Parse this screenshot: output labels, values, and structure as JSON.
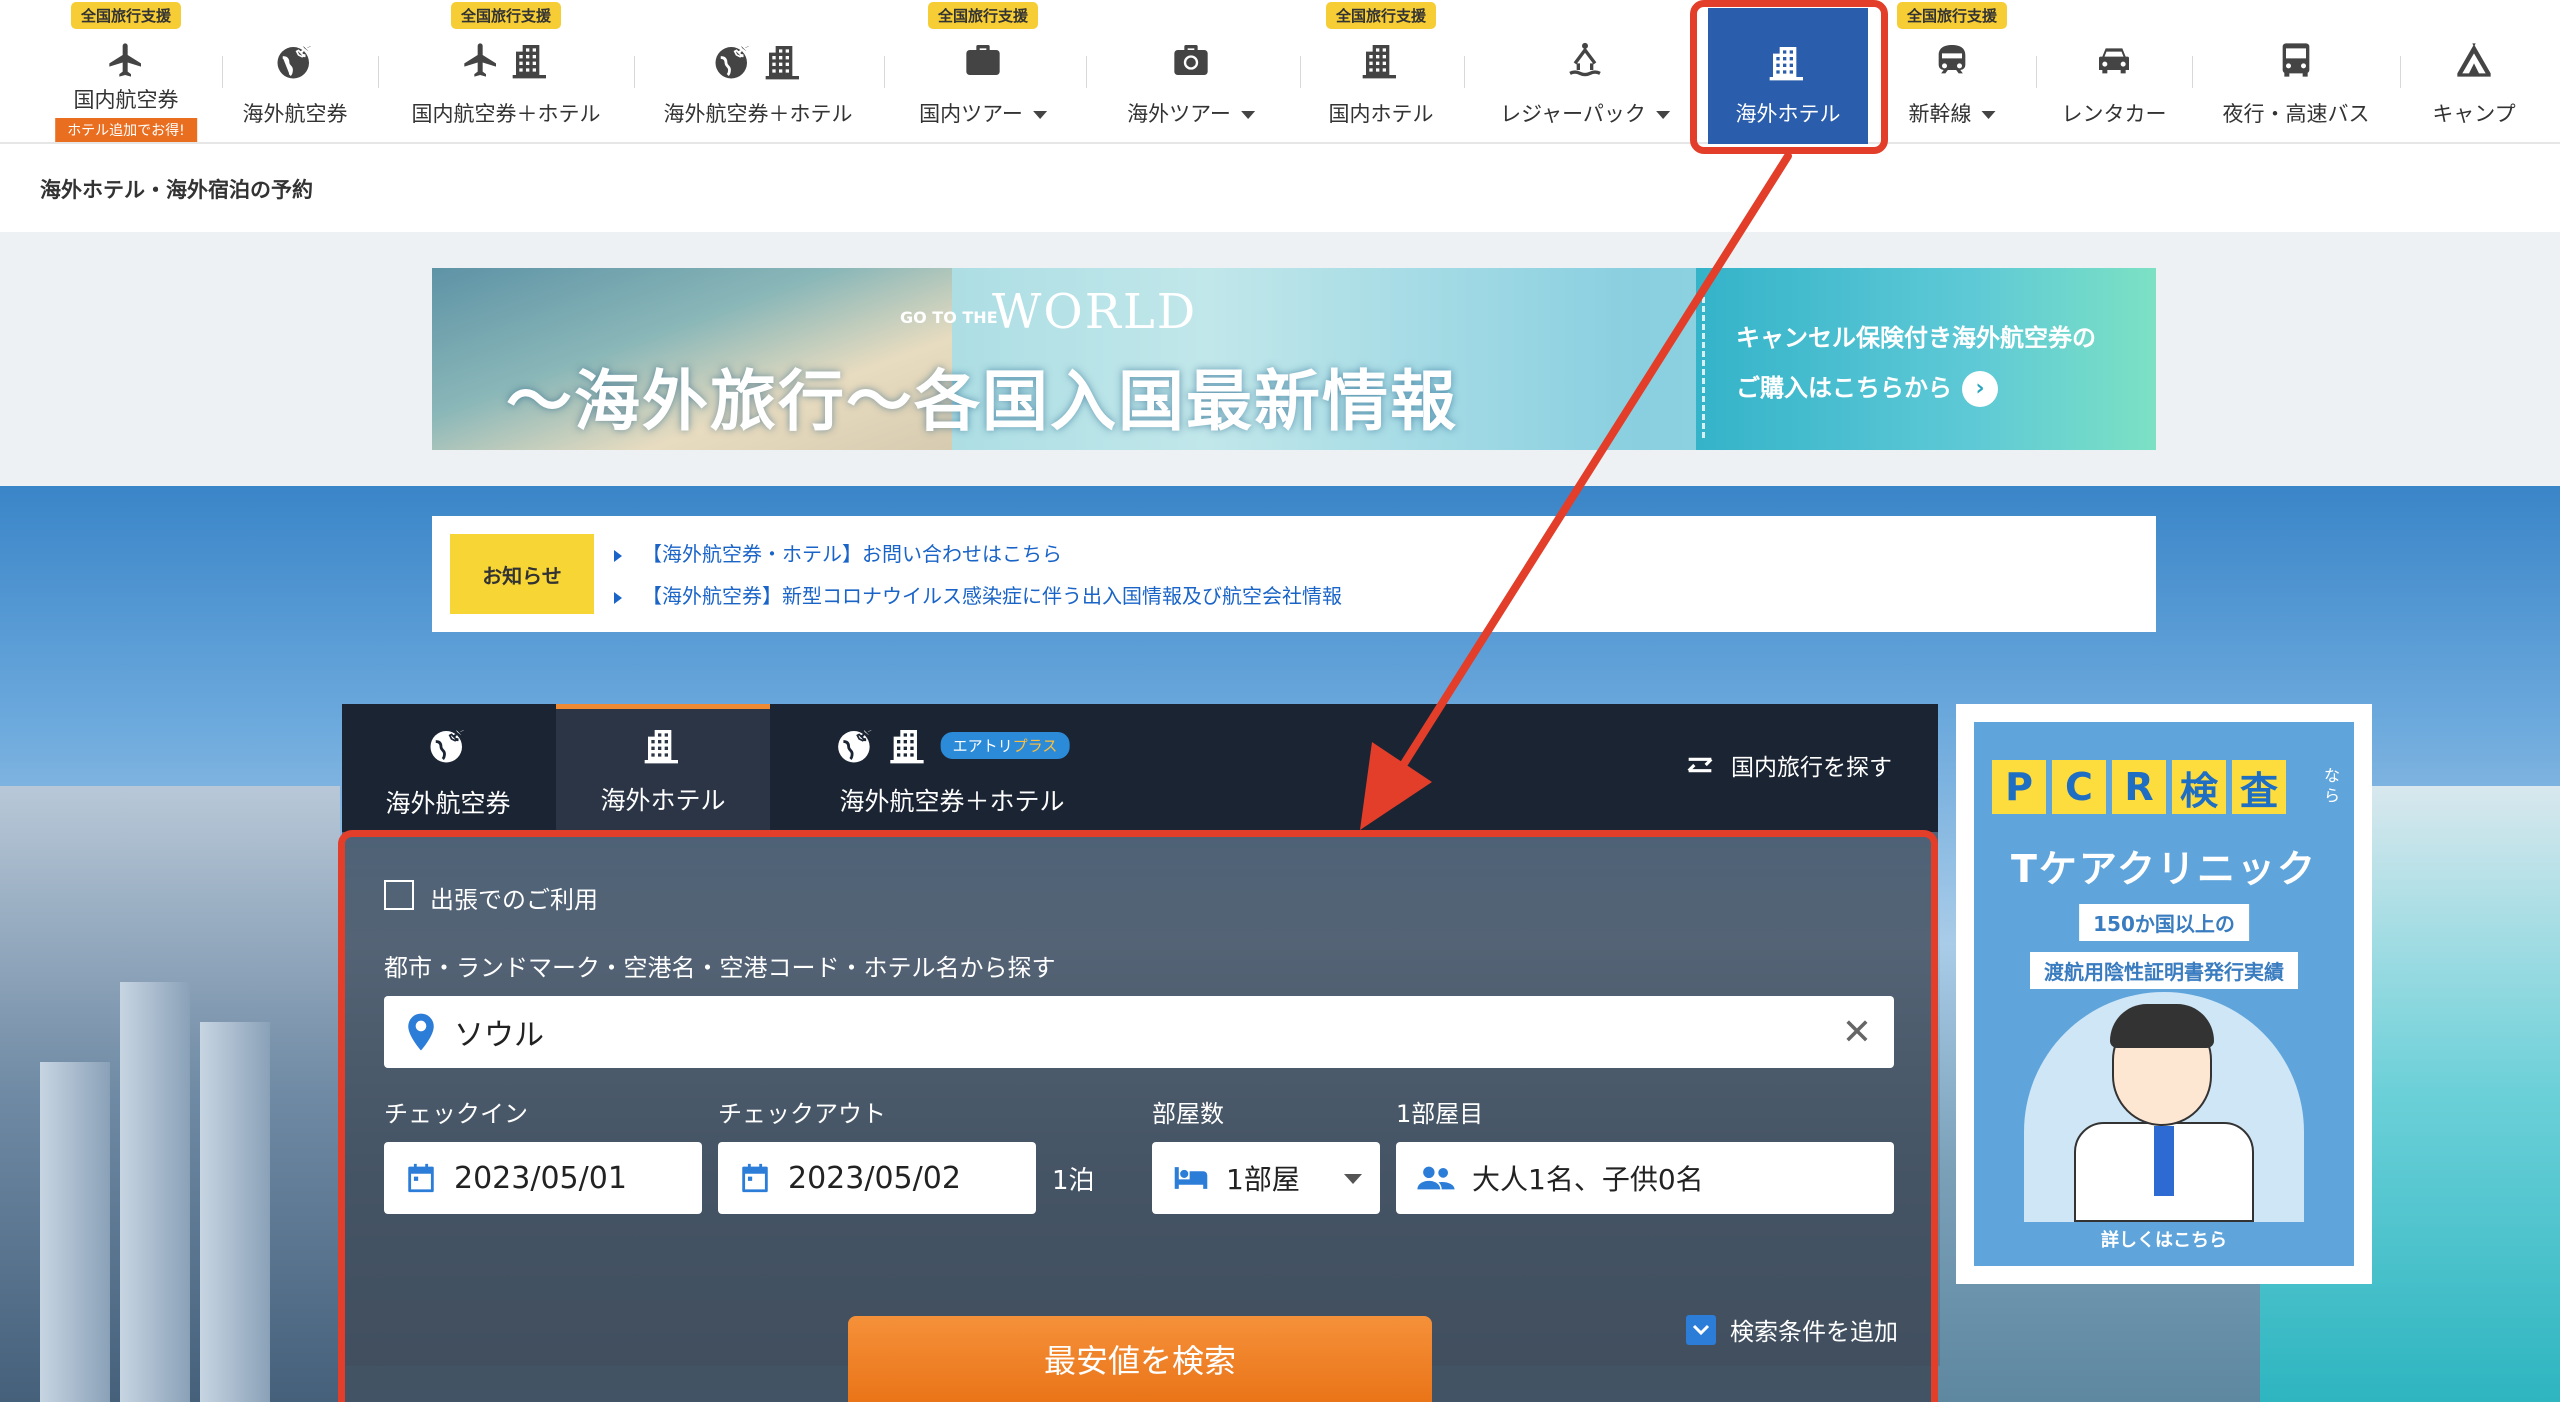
{
  "nav": {
    "items": [
      {
        "label": "国内航空券",
        "badge": "全国旅行支援",
        "sub_badge": "ホテル追加でお得!"
      },
      {
        "label": "海外航空券"
      },
      {
        "label": "国内航空券＋ホテル",
        "badge": "全国旅行支援"
      },
      {
        "label": "海外航空券＋ホテル"
      },
      {
        "label": "国内ツアー",
        "badge": "全国旅行支援"
      },
      {
        "label": "海外ツアー"
      },
      {
        "label": "国内ホテル",
        "badge": "全国旅行支援"
      },
      {
        "label": "レジャーパック"
      },
      {
        "label": "海外ホテル"
      },
      {
        "label": "新幹線",
        "badge": "全国旅行支援"
      },
      {
        "label": "レンタカー"
      },
      {
        "label": "夜行・高速バス"
      },
      {
        "label": "キャンプ"
      }
    ],
    "active_color": "#2a5dab",
    "badge_color": "#f6cd35"
  },
  "breadcrumb": "海外ホテル・海外宿泊の予約",
  "banner": {
    "goto": "GO TO THE",
    "world": "WORLD",
    "headline": "〜海外旅行〜各国入国最新情報",
    "right_line1": "キャンセル保険付き海外航空券の",
    "right_line2": "ご購入はこちらから"
  },
  "notice": {
    "tag": "お知らせ",
    "links": [
      "【海外航空券・ホテル】お問い合わせはこちら",
      "【海外航空券】新型コロナウイルス感染症に伴う出入国情報及び航空会社情報"
    ]
  },
  "search": {
    "tabs": [
      {
        "label": "海外航空券"
      },
      {
        "label": "海外ホテル"
      },
      {
        "label": "海外航空券＋ホテル",
        "badge": "エアトリ",
        "badge_plus": "プラス"
      }
    ],
    "swap_label": "国内旅行を探す",
    "business_label": "出張でのご利用",
    "destination_label": "都市・ランドマーク・空港名・空港コード・ホテル名から探す",
    "destination_value": "ソウル",
    "checkin_label": "チェックイン",
    "checkin_value": "2023/05/01",
    "checkout_label": "チェックアウト",
    "checkout_value": "2023/05/02",
    "nights": "1泊",
    "rooms_label": "部屋数",
    "rooms_value": "1部屋",
    "room1_label": "1部屋目",
    "guests_value": "大人1名、子供0名",
    "add_condition": "検索条件を追加",
    "search_button": "最安値を検索",
    "accent": "#ee8a34",
    "link_color": "#1a64c8"
  },
  "side_ad": {
    "pcr": [
      "P",
      "C",
      "R",
      "検",
      "査"
    ],
    "nara": "なら",
    "title": "Tケアクリニック",
    "pill1": "150か国以上の",
    "pill2": "渡航用陰性証明書発行実績",
    "more": "詳しくはこちら"
  },
  "annotation_color": "#e23e2a"
}
